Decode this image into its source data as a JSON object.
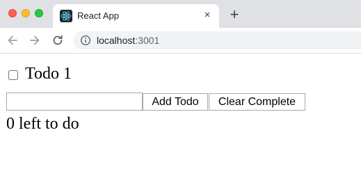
{
  "browser": {
    "tab": {
      "title": "React App",
      "favicon": "react-logo-icon"
    },
    "new_tab": "+",
    "close_tab": "×",
    "address": {
      "host": "localhost",
      "port": ":3001"
    },
    "icons": {
      "back": "back-arrow-icon",
      "forward": "forward-arrow-icon",
      "reload": "reload-icon",
      "info": "info-icon"
    },
    "colors": {
      "chrome_bg": "#dfe1e5",
      "omnibox_bg": "#f1f3f4",
      "close_light": "#fe5f57",
      "minimize_light": "#febc2e",
      "zoom_light": "#28c840",
      "react_blue": "#61dafb"
    }
  },
  "app": {
    "todos": [
      {
        "text": "Todo 1",
        "completed": false
      }
    ],
    "new_todo_value": "",
    "add_button": "Add Todo",
    "clear_button": "Clear Complete",
    "remaining_text": "0 left to do"
  }
}
